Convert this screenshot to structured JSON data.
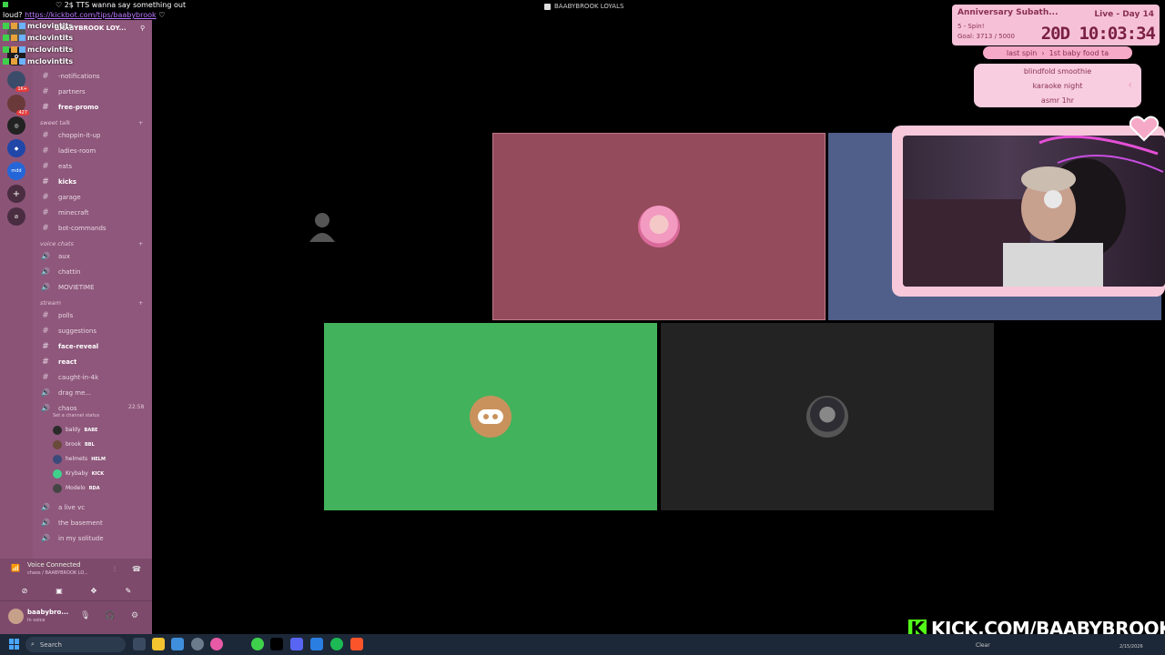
{
  "ticker": {
    "line1_prefix": "2$ TTS wanna say something out",
    "line2_prefix": "loud?",
    "link": "https://kickbot.com/tips/baabybrook",
    "heart": "♡"
  },
  "window_title": "BAABYBROOK LOYALS",
  "chat": [
    {
      "name": "mclovintits",
      "text": ""
    },
    {
      "name": "mclovintits",
      "text": ""
    },
    {
      "name": "mclovintits",
      "text": ""
    },
    {
      "name": "mclovintits",
      "text": ""
    }
  ],
  "server_header": "BAABYBROOK LOY...",
  "rail_servers": [
    "",
    "1K+",
    "427",
    "",
    "",
    "mdd",
    "+",
    "compass"
  ],
  "channels": [
    {
      "type": "text",
      "label": "-notifications"
    },
    {
      "type": "text",
      "label": "partners"
    },
    {
      "type": "text",
      "label": "free-promo",
      "bold": true
    },
    {
      "type": "category",
      "label": "sweet talk"
    },
    {
      "type": "text",
      "label": "choppin-it-up"
    },
    {
      "type": "text",
      "label": "ladies-room"
    },
    {
      "type": "text",
      "label": "eats"
    },
    {
      "type": "text",
      "label": "kicks",
      "bold": true
    },
    {
      "type": "text",
      "label": "garage"
    },
    {
      "type": "text",
      "label": "minecraft"
    },
    {
      "type": "text",
      "label": "bot-commands"
    },
    {
      "type": "category",
      "label": "voice chats"
    },
    {
      "type": "voice",
      "label": "aux"
    },
    {
      "type": "voice",
      "label": "chattin"
    },
    {
      "type": "voice",
      "label": "MOVIETIME"
    },
    {
      "type": "category",
      "label": "stream"
    },
    {
      "type": "text",
      "label": "polls"
    },
    {
      "type": "text",
      "label": "suggestions"
    },
    {
      "type": "text",
      "label": "face-reveal",
      "bold": true
    },
    {
      "type": "text",
      "label": "react",
      "bold": true
    },
    {
      "type": "text",
      "label": "caught-in-4k"
    },
    {
      "type": "voice",
      "label": "drag me..."
    },
    {
      "type": "voice",
      "label": "chaos",
      "active": true
    }
  ],
  "chaos_time": "22:58",
  "chaos_status": "Set a channel status",
  "voice_users": [
    {
      "name": "baldy",
      "tag": "BABE"
    },
    {
      "name": "brook",
      "tag": "BBL"
    },
    {
      "name": "helmets",
      "tag": "HELM"
    },
    {
      "name": "Krybaby",
      "tag": "KICK"
    },
    {
      "name": "Modelo",
      "tag": "RDA"
    }
  ],
  "after_channels": [
    {
      "type": "voice",
      "label": "a live vc"
    },
    {
      "type": "voice",
      "label": "the basement"
    },
    {
      "type": "voice",
      "label": "in my solitude"
    }
  ],
  "voice_panel": {
    "title": "Voice Connected",
    "subtitle": "chaos / BAABYBROOK LO..."
  },
  "user_panel": {
    "name": "baabybro...",
    "status": "In voice"
  },
  "colors": {
    "sidebar": "#8e577b",
    "rail": "#8b5477",
    "tile_pink": "#944b5b",
    "tile_blue": "#4f5f8a",
    "tile_green": "#43b25c",
    "tile_dark": "#232324",
    "kick_green": "#53fc18"
  },
  "widget": {
    "title": "Anniversary Subath...",
    "live": "Live - Day 14",
    "spin": "5 - Spin!",
    "goal": "Goal: 3713 / 5000",
    "timer": "20D 10:03:34",
    "last_spin_label": "last spin",
    "last_spin_value": "1st baby food ta",
    "wheel_options": [
      "blindfold smoothie",
      "karaoke night",
      "asmr 1hr"
    ]
  },
  "kick_banner": "KICK.COM/BAABYBROOK",
  "taskbar": {
    "search_placeholder": "Search",
    "tray_clear": "Clear",
    "date": "2/15/2026"
  }
}
